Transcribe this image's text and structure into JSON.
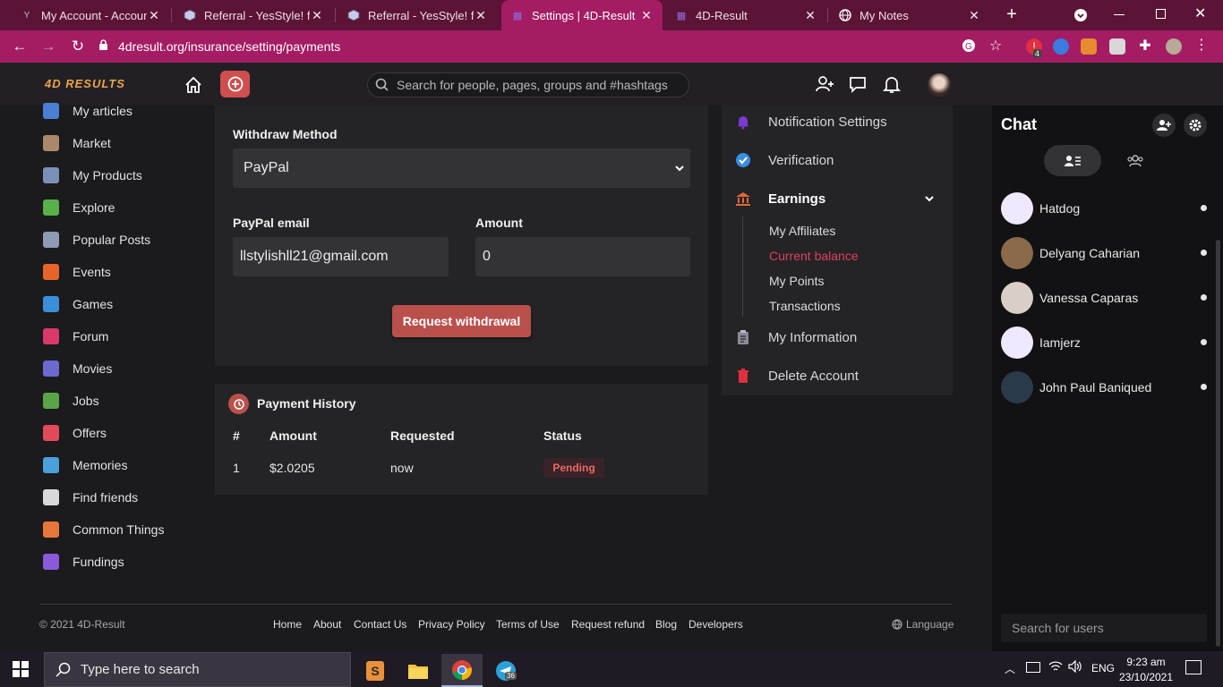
{
  "browser": {
    "tabs": [
      {
        "label": "My Account - Account",
        "icon": "yesstyle-icon"
      },
      {
        "label": "Referral - YesStyle! free",
        "icon": "box-icon"
      },
      {
        "label": "Referral - YesStyle! free",
        "icon": "box-icon"
      },
      {
        "label": "Settings | 4D-Result",
        "icon": "4d-icon",
        "active": true
      },
      {
        "label": "4D-Result",
        "icon": "4d-icon"
      },
      {
        "label": "My Notes",
        "icon": "globe-icon"
      }
    ],
    "new_tab": "+",
    "url": "4dresult.org/insurance/setting/payments",
    "ext_badge": "4"
  },
  "header": {
    "logo_text": "4D RESULTS",
    "search_placeholder": "Search for people, pages, groups and #hashtags"
  },
  "sidebar": {
    "items": [
      {
        "label": "My articles",
        "icon": "articles-icon",
        "color": "#4a7fd4"
      },
      {
        "label": "Market",
        "icon": "market-icon",
        "color": "#a88a6a"
      },
      {
        "label": "My Products",
        "icon": "products-icon",
        "color": "#7b8fb8"
      },
      {
        "label": "Explore",
        "icon": "explore-icon",
        "color": "#58b04a"
      },
      {
        "label": "Popular Posts",
        "icon": "posts-icon",
        "color": "#8e9bb5"
      },
      {
        "label": "Events",
        "icon": "events-icon",
        "color": "#e6642a"
      },
      {
        "label": "Games",
        "icon": "games-icon",
        "color": "#3b8fd8"
      },
      {
        "label": "Forum",
        "icon": "forum-icon",
        "color": "#d93a6a"
      },
      {
        "label": "Movies",
        "icon": "movies-icon",
        "color": "#6a6ad0"
      },
      {
        "label": "Jobs",
        "icon": "jobs-icon",
        "color": "#5aa44a"
      },
      {
        "label": "Offers",
        "icon": "offers-icon",
        "color": "#e24a5a"
      },
      {
        "label": "Memories",
        "icon": "memories-icon",
        "color": "#4aa0d8"
      },
      {
        "label": "Find friends",
        "icon": "find-friends-icon",
        "color": "#d8d8d8"
      },
      {
        "label": "Common Things",
        "icon": "common-things-icon",
        "color": "#e8763a"
      },
      {
        "label": "Fundings",
        "icon": "fundings-icon",
        "color": "#8a5ad8"
      }
    ]
  },
  "withdraw": {
    "method_label": "Withdraw Method",
    "method_value": "PayPal",
    "email_label": "PayPal email",
    "email_value": "llstylishll21@gmail.com",
    "amount_label": "Amount",
    "amount_value": "0",
    "button": "Request withdrawal"
  },
  "history": {
    "title": "Payment History",
    "columns": [
      "#",
      "Amount",
      "Requested",
      "Status"
    ],
    "rows": [
      {
        "num": "1",
        "amount": "$2.0205",
        "requested": "now",
        "status": "Pending"
      }
    ]
  },
  "settings_menu": {
    "notification": "Notification Settings",
    "verification": "Verification",
    "earnings": "Earnings",
    "sub": [
      "My Affiliates",
      "Current balance",
      "My Points",
      "Transactions"
    ],
    "info": "My Information",
    "delete": "Delete Account",
    "active_color": "#e0405a"
  },
  "chat": {
    "title": "Chat",
    "users": [
      "Hatdog",
      "Delyang Caharian",
      "Vanessa Caparas",
      "Iamjerz",
      "John Paul Baniqued"
    ],
    "search_placeholder": "Search for users"
  },
  "footer": {
    "copyright": "© 2021 4D-Result",
    "links": [
      "Home",
      "About",
      "Contact Us",
      "Privacy Policy",
      "Terms of Use",
      "Request refund",
      "Blog",
      "Developers"
    ],
    "language": "Language"
  },
  "taskbar": {
    "search_placeholder": "Type here to search",
    "lang": "ENG",
    "time": "9:23 am",
    "date": "23/10/2021",
    "telegram_badge": "36"
  }
}
